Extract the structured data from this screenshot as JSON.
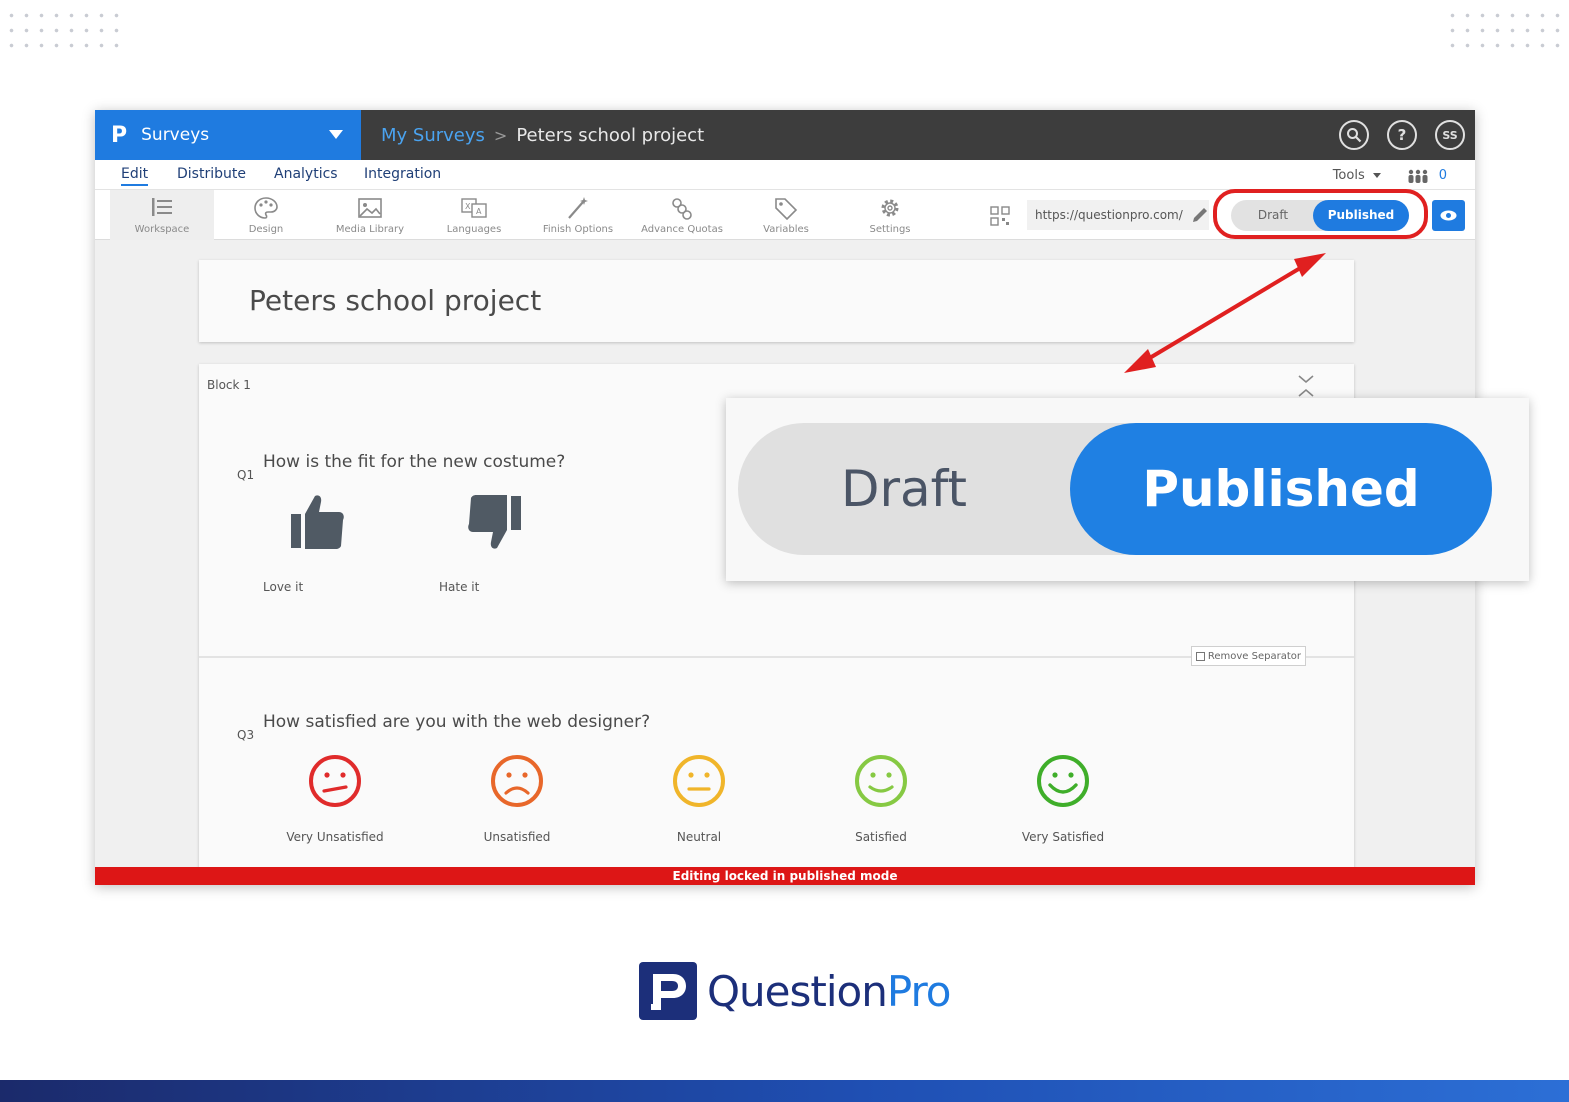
{
  "app": {
    "brand_title": "Surveys",
    "breadcrumb": {
      "parent": "My Surveys",
      "separator": ">",
      "current": "Peters school project"
    },
    "top_icons": [
      "search-icon",
      "help-icon",
      "user-avatar"
    ],
    "avatar_initials": "SS"
  },
  "nav": {
    "tabs": [
      {
        "label": "Edit",
        "active": true
      },
      {
        "label": "Distribute",
        "active": false
      },
      {
        "label": "Analytics",
        "active": false
      },
      {
        "label": "Integration",
        "active": false
      }
    ],
    "tools_label": "Tools",
    "collaborators_count": "0"
  },
  "toolbar": {
    "items": [
      {
        "label": "Workspace",
        "icon": "workspace-icon"
      },
      {
        "label": "Design",
        "icon": "palette-icon"
      },
      {
        "label": "Media Library",
        "icon": "image-icon"
      },
      {
        "label": "Languages",
        "icon": "translate-icon"
      },
      {
        "label": "Finish Options",
        "icon": "magic-wand-icon"
      },
      {
        "label": "Advance Quotas",
        "icon": "links-icon"
      },
      {
        "label": "Variables",
        "icon": "tag-icon"
      },
      {
        "label": "Settings",
        "icon": "gear-icon"
      }
    ],
    "url": "https://questionpro.com/",
    "toggle": {
      "draft_label": "Draft",
      "published_label": "Published",
      "selected": "Published"
    }
  },
  "survey": {
    "title": "Peters school project",
    "block_label": "Block 1",
    "questions": [
      {
        "number": "Q1",
        "text": "How is the fit for the new costume?",
        "options": [
          {
            "label": "Love it",
            "icon": "thumbs-up-icon"
          },
          {
            "label": "Hate it",
            "icon": "thumbs-down-icon"
          }
        ]
      },
      {
        "number": "Q3",
        "text": "How satisfied are you with the web designer?",
        "options": [
          {
            "label": "Very Unsatisfied",
            "color": "#e02b2b"
          },
          {
            "label": "Unsatisfied",
            "color": "#e8672a"
          },
          {
            "label": "Neutral",
            "color": "#f0b52a"
          },
          {
            "label": "Satisfied",
            "color": "#86c943"
          },
          {
            "label": "Very Satisfied",
            "color": "#3fae2a"
          }
        ]
      }
    ],
    "remove_separator_label": "Remove Separator"
  },
  "status_bar": "Editing locked in published mode",
  "callout": {
    "draft_label": "Draft",
    "published_label": "Published"
  },
  "footer": {
    "logo_text_a": "Question",
    "logo_text_b": "Pro"
  },
  "colors": {
    "accent": "#1f7be0",
    "topbar": "#3d3d3d",
    "locked": "#dd1616",
    "highlight": "#e02020",
    "logo": "#1c2f7a"
  }
}
